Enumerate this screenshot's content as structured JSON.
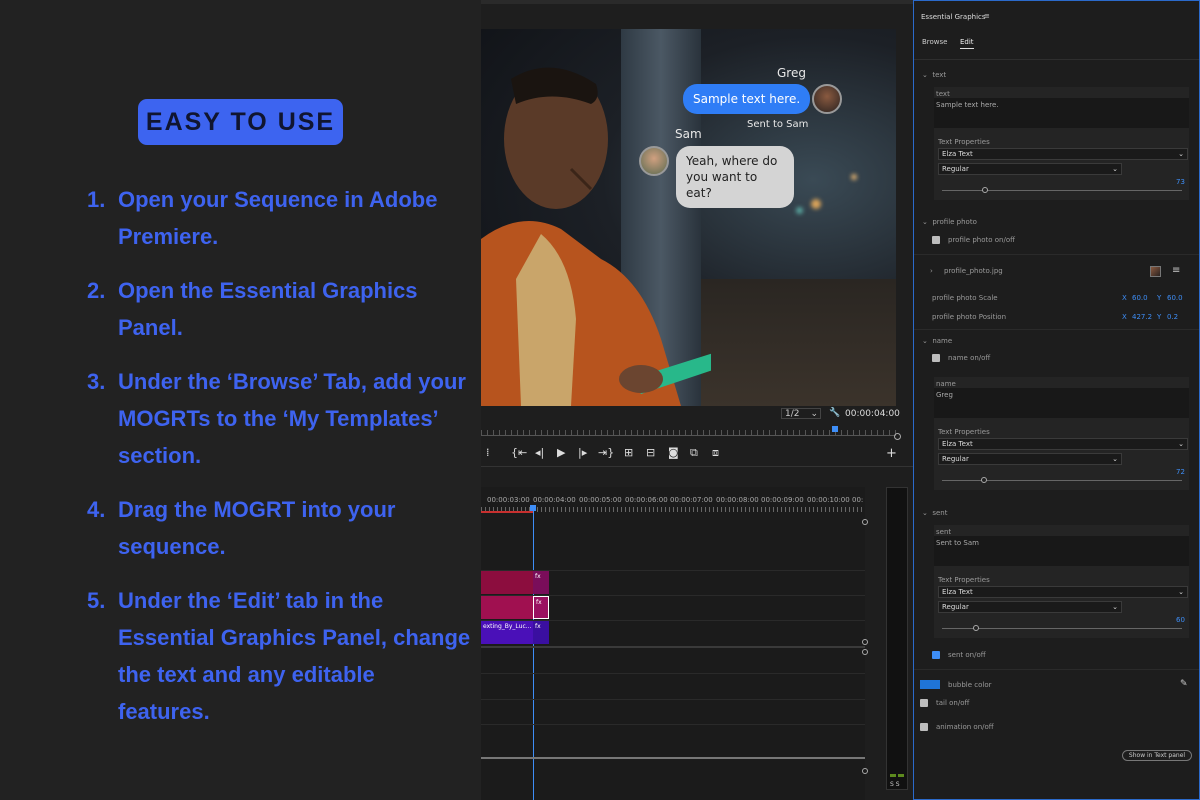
{
  "left": {
    "badge": "EASY TO USE",
    "steps": [
      {
        "n": "1.",
        "text": "Open your Sequence in Adobe Premiere."
      },
      {
        "n": "2.",
        "text": "Open the Essential Graphics Panel."
      },
      {
        "n": "3.",
        "text": "Under the ‘Browse’ Tab, add your MOGRTs to the ‘My Templates’ section."
      },
      {
        "n": "4.",
        "text": "Drag the MOGRT into your sequence."
      },
      {
        "n": "5.",
        "text": "Under the ‘Edit’ tab in the Essential Graphics Panel, change the text and any editable features."
      }
    ]
  },
  "preview": {
    "greg_name": "Greg",
    "greg_msg": "Sample text here.",
    "sent_label": "Sent to Sam",
    "sam_name": "Sam",
    "sam_msg": "Yeah, where do you want to eat?",
    "resolution": "1/2",
    "timecode": "00:00:04:00"
  },
  "timeline": {
    "ticks": [
      "00:00:03:00",
      "00:00:04:00",
      "00:00:05:00",
      "00:00:06:00",
      "00:00:07:00",
      "00:00:08:00",
      "00:00:09:00",
      "00:00:10:00",
      "00:"
    ],
    "clip_label": "exting_By_Luc...",
    "fx": "fx",
    "meter_label": "S S"
  },
  "panel": {
    "title": "Essential Graphics",
    "tab_browse": "Browse",
    "tab_edit": "Edit",
    "sec_text": "text",
    "text_label": "text",
    "text_value": "Sample text here.",
    "text_props": "Text Properties",
    "font": "Elza Text",
    "style": "Regular",
    "size1": "73",
    "sec_profile": "profile photo",
    "profile_onoff": "profile photo on/off",
    "profile_file": "profile_photo.jpg",
    "profile_scale": "profile photo Scale",
    "scale_x_label": "X",
    "scale_x": "60.0",
    "scale_y_label": "Y",
    "scale_y": "60.0",
    "profile_position": "profile photo Position",
    "pos_x_label": "X",
    "pos_x": "427.2",
    "pos_y_label": "Y",
    "pos_y": "0.2",
    "sec_name": "name",
    "name_onoff": "name on/off",
    "name_label": "name",
    "name_value": "Greg",
    "size2": "72",
    "sec_sent": "sent",
    "sent_label": "sent",
    "sent_value": "Sent to Sam",
    "size3": "60",
    "sent_onoff": "sent on/off",
    "bubble_color": "bubble color",
    "bubble_hex": "#1f74d6",
    "tail_onoff": "tail on/off",
    "animation_onoff": "animation on/off",
    "show_button": "Show in Text panel"
  }
}
